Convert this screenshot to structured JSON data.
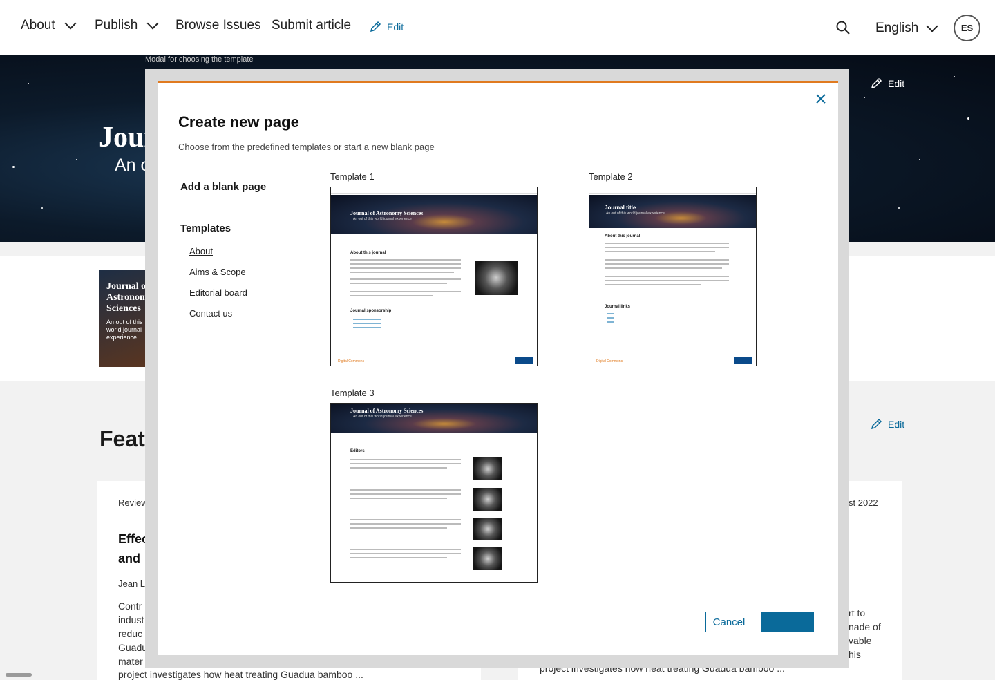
{
  "nav": {
    "about": "About",
    "publish": "Publish",
    "browse": "Browse Issues",
    "submit": "Submit article",
    "edit": "Edit",
    "language": "English",
    "avatar_initials": "ES"
  },
  "hero": {
    "title_partial": "Jour",
    "subtitle_partial": "An o",
    "edit": "Edit",
    "modal_caption": "Modal for choosing the template"
  },
  "cover": {
    "title": "Journal of Astronomy Sciences",
    "subtitle": "An out of this world journal experience"
  },
  "featured": {
    "heading_partial": "Feat",
    "edit": "Edit",
    "card1": {
      "type_partial": "Review",
      "title_line1": "Effec",
      "title_line2": "and",
      "author_partial": "Jean Le",
      "body_lines": [
        "Contr",
        "indust",
        "reduc",
        "Guadu",
        "mater"
      ],
      "last_line": "project investigates how heat treating Guadua bamboo ..."
    },
    "card2": {
      "date_partial": "st 2022",
      "body_lines": [
        "rt to",
        "nade of",
        "vable",
        "his"
      ],
      "last_line": "project investigates how heat treating Guadua bamboo ..."
    }
  },
  "modal": {
    "title": "Create new page",
    "subtitle": "Choose from the predefined templates or start a new blank page",
    "blank_page": "Add a blank page",
    "templates_heading": "Templates",
    "template_links": [
      "About",
      "Aims & Scope",
      "Editorial board",
      "Contact us"
    ],
    "templates": [
      {
        "label": "Template 1",
        "journal_title": "Journal of Astronomy Sciences",
        "journal_sub": "An out of this world journal experience",
        "section": "About this journal",
        "section2": "Journal sponsorship"
      },
      {
        "label": "Template 2",
        "journal_title": "Journal title",
        "journal_sub": "An out of this world journal experience",
        "section": "About this journal",
        "section2": "Journal links"
      },
      {
        "label": "Template 3",
        "journal_title": "Journal of Astronomy Sciences",
        "journal_sub": "An out of this world journal experience",
        "section": "Editors"
      }
    ],
    "cancel": "Cancel",
    "confirm": ""
  },
  "colors": {
    "accent": "#0a6a9a",
    "modal_border": "#e07a1f"
  }
}
